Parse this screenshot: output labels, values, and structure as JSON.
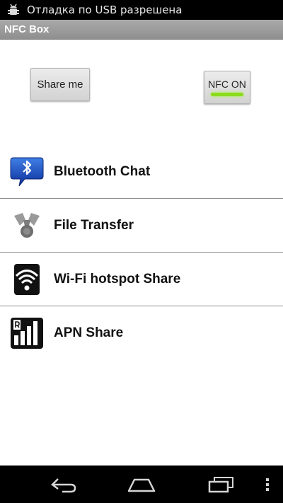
{
  "status_bar": {
    "notification_text": "Отладка по USB разрешена",
    "icon": "usb-debugging-icon"
  },
  "app": {
    "title": "NFC Box"
  },
  "controls": {
    "share_button_label": "Share me",
    "nfc_button_label": "NFC ON",
    "nfc_indicator_color": "#8bdc1c"
  },
  "menu": {
    "items": [
      {
        "label": "Bluetooth Chat",
        "icon": "bluetooth-chat-icon"
      },
      {
        "label": "File Transfer",
        "icon": "file-transfer-icon"
      },
      {
        "label": "Wi-Fi hotspot Share",
        "icon": "wifi-hotspot-icon"
      },
      {
        "label": "APN Share",
        "icon": "apn-signal-icon"
      }
    ]
  },
  "nav_bar": {
    "buttons": [
      "back-icon",
      "home-icon",
      "recent-apps-icon",
      "overflow-menu-icon"
    ]
  }
}
